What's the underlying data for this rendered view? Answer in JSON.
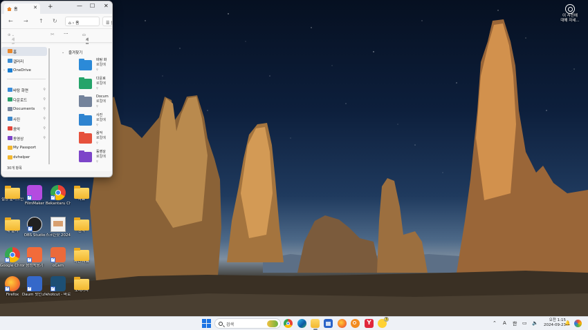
{
  "explorer": {
    "tab_title": "홈",
    "address_crumb": "홈",
    "address_crumb2": "홈",
    "cmd_new": "새로 만들기",
    "cmd_details": "세부 정보",
    "nav_items": [
      {
        "label": "홈",
        "color": "#e9872b"
      },
      {
        "label": "갤러리",
        "color": "#3d8fd6"
      },
      {
        "label": "OneDrive",
        "color": "#1a7ed3"
      },
      {
        "label": "바탕 화면",
        "color": "#3b8edb"
      },
      {
        "label": "다운로드",
        "color": "#2aa16c"
      },
      {
        "label": "Documents",
        "color": "#7b8aa0"
      },
      {
        "label": "사진",
        "color": "#3f88c9"
      },
      {
        "label": "음악",
        "color": "#e2473b"
      },
      {
        "label": "동영상",
        "color": "#7d45c9"
      },
      {
        "label": "My Passport",
        "color": "#f2b830"
      },
      {
        "label": "dvhelper",
        "color": "#f2b830"
      },
      {
        "label": "에스파일 다운로",
        "color": "#f2b830"
      }
    ],
    "section_title": "즐겨찾기",
    "quick_access": [
      {
        "label": "바탕 화",
        "sub": "로컬에",
        "color": "#2b8ad8"
      },
      {
        "label": "다운로",
        "sub": "로컬에",
        "color": "#25a46a"
      },
      {
        "label": "Docum",
        "sub": "로컬에",
        "color": "#74839b"
      },
      {
        "label": "사진",
        "sub": "로컬에",
        "color": "#2f84d0"
      },
      {
        "label": "음악",
        "sub": "로컬에",
        "color": "#e6513c"
      },
      {
        "label": "동영상",
        "sub": "로컬에",
        "color": "#7d45c9"
      }
    ],
    "status": "30개 항목"
  },
  "desktop_icons": [
    {
      "label": "설정 플러그인",
      "kind": "folder"
    },
    {
      "label": "FilmMaker",
      "kind": "app",
      "color": "#b44be0"
    },
    {
      "label": "Bekantaru Chrome",
      "kind": "chrome"
    },
    {
      "label": "자료",
      "kind": "folder"
    },
    {
      "label": "새 폴더",
      "kind": "folder"
    },
    {
      "label": "OBS Studio",
      "kind": "obs"
    },
    {
      "label": "스크린샷 2024-07-..",
      "kind": "image"
    },
    {
      "label": "음악",
      "kind": "folder"
    },
    {
      "label": "Google Chrome",
      "kind": "chrome"
    },
    {
      "label": "음성녹음기",
      "kind": "app",
      "color": "#f26b3a"
    },
    {
      "label": "oCam",
      "kind": "app",
      "color": "#ea6a3b"
    },
    {
      "label": "사진 자료",
      "kind": "folder"
    },
    {
      "label": "Firefox",
      "kind": "firefox"
    },
    {
      "label": "Daum 팟인코더",
      "kind": "app",
      "color": "#3568c9"
    },
    {
      "label": "shotcut - 바로 가기",
      "kind": "app",
      "color": "#1d4f74"
    },
    {
      "label": "노래가사",
      "kind": "folder"
    }
  ],
  "widget": {
    "line1": "이 사진에",
    "line2": "대해 자세..."
  },
  "taskbar": {
    "search_placeholder": "검색",
    "lang": "A",
    "ime": "한",
    "time": "오전 1:15",
    "date": "2024-09-23",
    "notif_count": "3"
  }
}
